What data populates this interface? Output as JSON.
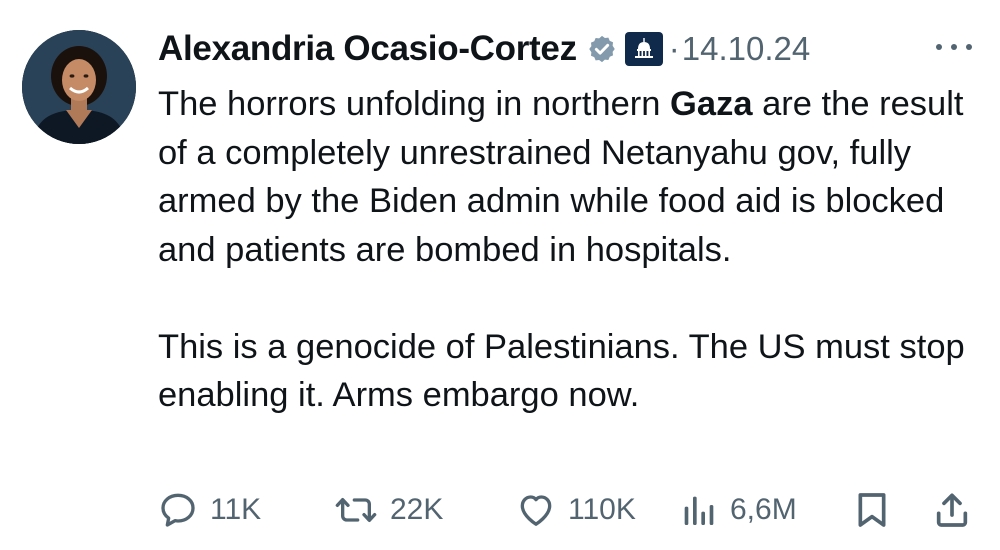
{
  "author": {
    "name": "Alexandria Ocasio-Cortez",
    "verified_icon": "verified-badge-icon",
    "affiliation_icon": "capitol-building-icon"
  },
  "tweet": {
    "separator": "·",
    "date": "14.10.24",
    "text_part1": "The horrors unfolding in northern ",
    "text_bold": "Gaza",
    "text_part2": " are the result of a completely unrestrained Netanyahu gov, fully armed by the Biden admin while food aid is blocked and patients are bombed in hospitals.",
    "text_para2": "This is a genocide of Palestinians. The US must stop enabling it. Arms embargo now."
  },
  "stats": {
    "replies": "11K",
    "reposts": "22K",
    "likes": "110K",
    "views": "6,6M"
  },
  "colors": {
    "text": "#0f1419",
    "secondary": "#536471",
    "verified": "#829aab",
    "gov_badge": "#0f2a4a"
  }
}
